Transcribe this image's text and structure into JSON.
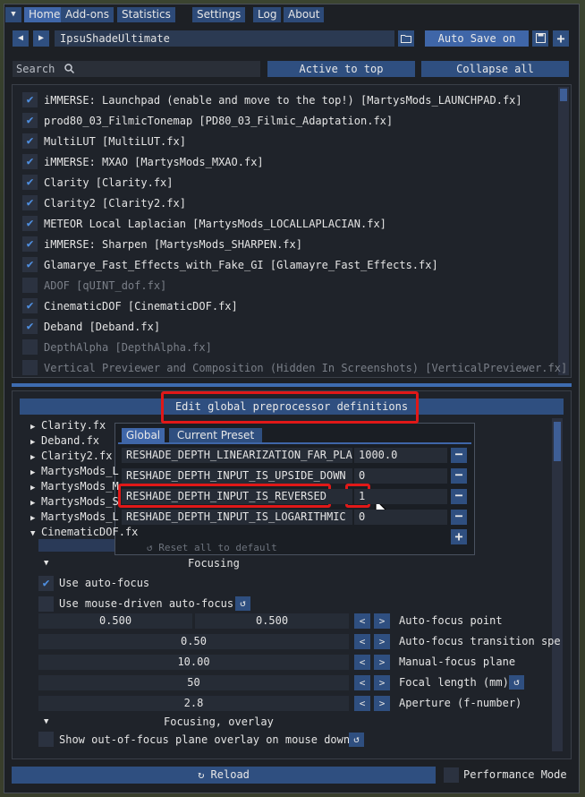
{
  "nav": {
    "tabs": [
      "Home",
      "Add-ons",
      "Statistics",
      "Settings",
      "Log",
      "About"
    ],
    "active": 0
  },
  "preset": {
    "name": "IpsuShadeUltimate",
    "autosave_label": "Auto Save on"
  },
  "search": {
    "placeholder": "Search",
    "active_to_top": "Active to top",
    "collapse_all": "Collapse all"
  },
  "effects": [
    {
      "label": "iMMERSE: Launchpad (enable and move to the top!) [MartysMods_LAUNCHPAD.fx]",
      "enabled": true
    },
    {
      "label": "prod80_03_FilmicTonemap [PD80_03_Filmic_Adaptation.fx]",
      "enabled": true
    },
    {
      "label": "MultiLUT [MultiLUT.fx]",
      "enabled": true
    },
    {
      "label": "iMMERSE: MXAO [MartysMods_MXAO.fx]",
      "enabled": true
    },
    {
      "label": "Clarity [Clarity.fx]",
      "enabled": true
    },
    {
      "label": "Clarity2 [Clarity2.fx]",
      "enabled": true
    },
    {
      "label": "METEOR Local Laplacian [MartysMods_LOCALLAPLACIAN.fx]",
      "enabled": true
    },
    {
      "label": "iMMERSE: Sharpen [MartysMods_SHARPEN.fx]",
      "enabled": true
    },
    {
      "label": "Glamarye_Fast_Effects_with_Fake_GI [Glamayre_Fast_Effects.fx]",
      "enabled": true
    },
    {
      "label": "ADOF [qUINT_dof.fx]",
      "enabled": false
    },
    {
      "label": "CinematicDOF [CinematicDOF.fx]",
      "enabled": true
    },
    {
      "label": "Deband [Deband.fx]",
      "enabled": true
    },
    {
      "label": "DepthAlpha [DepthAlpha.fx]",
      "enabled": false
    },
    {
      "label": "Vertical Previewer and Composition (Hidden In Screenshots) [VerticalPreviewer.fx]",
      "enabled": false
    }
  ],
  "preproc": {
    "button": "Edit global preprocessor definitions",
    "tabs": [
      "Global",
      "Current Preset"
    ],
    "defs": [
      {
        "name": "RESHADE_DEPTH_LINEARIZATION_FAR_PLANE",
        "value": "1000.0"
      },
      {
        "name": "RESHADE_DEPTH_INPUT_IS_UPSIDE_DOWN",
        "value": "0"
      },
      {
        "name": "RESHADE_DEPTH_INPUT_IS_REVERSED",
        "value": "1"
      },
      {
        "name": "RESHADE_DEPTH_INPUT_IS_LOGARITHMIC",
        "value": "0"
      }
    ],
    "reset_label": "Reset all to default"
  },
  "tree": [
    "Clarity.fx",
    "Deband.fx",
    "Clarity2.fx",
    "MartysMods_L",
    "MartysMods_M",
    "MartysMods_S",
    "MartysMods_L",
    "CinematicDOF.fx"
  ],
  "dof": {
    "focusing_header": "Focusing",
    "use_autofocus": "Use auto-focus",
    "mouse_autofocus": "Use mouse-driven auto-focus",
    "params": [
      {
        "values": [
          "0.500",
          "0.500"
        ],
        "label": "Auto-focus point"
      },
      {
        "values": [
          "0.50"
        ],
        "label": "Auto-focus transition spe"
      },
      {
        "values": [
          "10.00"
        ],
        "label": "Manual-focus plane"
      },
      {
        "values": [
          "50"
        ],
        "label": "Focal length (mm)"
      },
      {
        "values": [
          "2.8"
        ],
        "label": "Aperture (f-number)"
      }
    ],
    "overlay_header": "Focusing, overlay",
    "overlay_option": "Show out-of-focus plane overlay on mouse down"
  },
  "footer": {
    "reload": "Reload",
    "performance": "Performance Mode"
  }
}
